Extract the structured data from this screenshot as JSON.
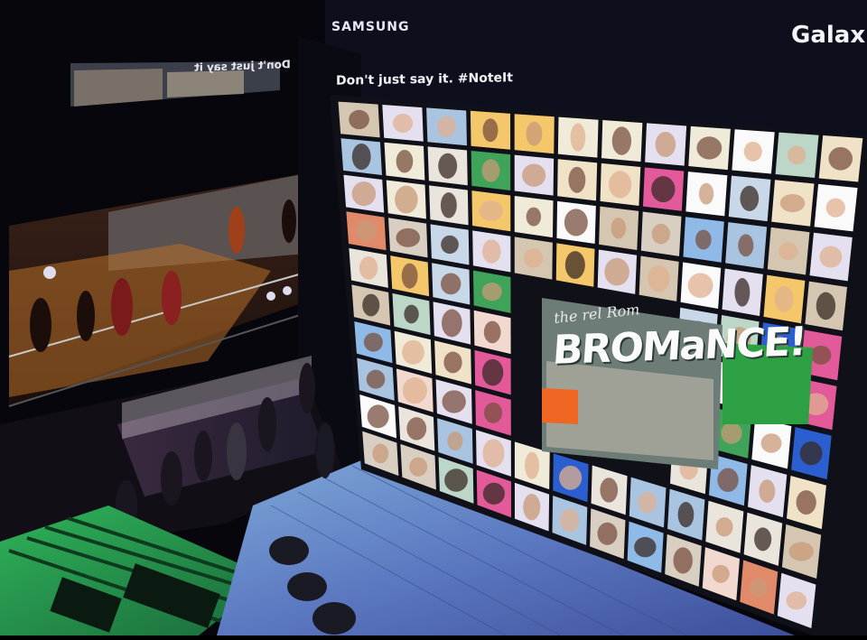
{
  "photo": {
    "description_hidden": false,
    "brand_text": "SAMSUNG",
    "product_text": "Galax",
    "tagline_text": "Don't just say it. #NoteIt",
    "mirror_text": "Don't just say it",
    "mural_text": "BROMaNCE!",
    "mural_subtext": "the rel Rom"
  },
  "palette": {
    "wall_bg": "#0b0d1a",
    "floor": "#5a7fb8",
    "stairs": "#2f9a4e",
    "screen_frame": "#101018"
  }
}
